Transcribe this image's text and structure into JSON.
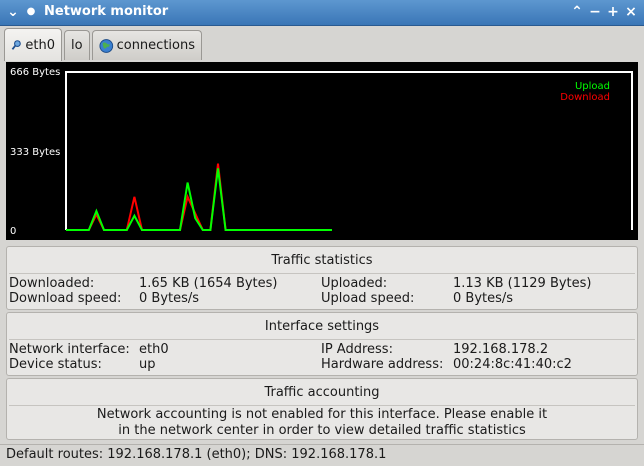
{
  "window": {
    "title": "Network monitor",
    "controls": {
      "menu": "⌄",
      "minimize": "−",
      "maximize": "+",
      "close": "×"
    }
  },
  "tabs": [
    {
      "label": "eth0",
      "icon": "magnifier-icon",
      "active": true
    },
    {
      "label": "lo",
      "icon": "",
      "active": false
    },
    {
      "label": "connections",
      "icon": "globe-icon",
      "active": false
    }
  ],
  "chart_data": {
    "type": "line",
    "y_tick_labels": [
      "666 Bytes",
      "333 Bytes",
      "0"
    ],
    "ylim": [
      0,
      666
    ],
    "x": [
      0,
      1,
      2,
      3,
      4,
      5,
      6,
      7,
      8,
      9,
      10,
      11,
      12,
      13,
      14,
      15,
      16,
      17,
      18,
      19,
      20,
      21,
      22,
      23,
      24,
      25,
      26,
      27,
      28,
      29,
      30,
      31,
      32,
      33,
      34,
      35
    ],
    "series": [
      {
        "name": "Upload",
        "color": "#00ff00",
        "values": [
          0,
          0,
          0,
          0,
          80,
          0,
          0,
          0,
          0,
          60,
          0,
          0,
          0,
          0,
          0,
          0,
          200,
          50,
          0,
          0,
          260,
          0,
          0,
          0,
          0,
          0,
          0,
          0,
          0,
          0,
          0,
          0,
          0,
          0,
          0,
          0
        ]
      },
      {
        "name": "Download",
        "color": "#ff0000",
        "values": [
          0,
          0,
          0,
          0,
          65,
          0,
          0,
          0,
          0,
          140,
          0,
          0,
          0,
          0,
          0,
          0,
          140,
          70,
          0,
          0,
          280,
          0,
          0,
          0,
          0,
          0,
          0,
          0,
          0,
          0,
          0,
          0,
          0,
          0,
          0,
          0
        ]
      }
    ],
    "legend_position": "top-right",
    "grid": false
  },
  "traffic_statistics": {
    "title": "Traffic statistics",
    "downloaded_label": "Downloaded:",
    "downloaded_value": "1.65 KB (1654 Bytes)",
    "download_speed_label": "Download speed:",
    "download_speed_value": "0 Bytes/s",
    "uploaded_label": "Uploaded:",
    "uploaded_value": "1.13 KB (1129 Bytes)",
    "upload_speed_label": "Upload speed:",
    "upload_speed_value": "0 Bytes/s"
  },
  "interface_settings": {
    "title": "Interface settings",
    "network_interface_label": "Network interface:",
    "network_interface_value": "eth0",
    "device_status_label": "Device status:",
    "device_status_value": "up",
    "ip_address_label": "IP Address:",
    "ip_address_value": "192.168.178.2",
    "hardware_address_label": "Hardware address:",
    "hardware_address_value": "00:24:8c:41:40:c2"
  },
  "traffic_accounting": {
    "title": "Traffic accounting",
    "message_line1": "Network accounting is not enabled for this interface. Please enable it",
    "message_line2": "in the network center in order to view detailed traffic statistics"
  },
  "statusbar": {
    "text": "Default routes: 192.168.178.1 (eth0); DNS: 192.168.178.1"
  }
}
